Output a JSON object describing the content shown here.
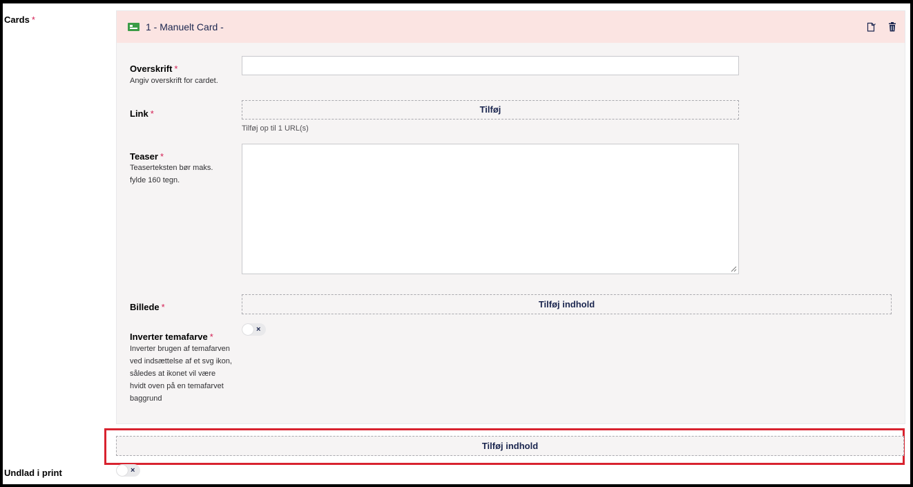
{
  "property": {
    "label": "Cards",
    "required_mark": "*"
  },
  "card": {
    "title": "1 - Manuelt Card -",
    "icon": "card-icon",
    "actions": {
      "copy_icon": "copy-icon",
      "delete_icon": "trash-icon"
    },
    "fields": {
      "overskrift": {
        "label": "Overskrift",
        "required_mark": "*",
        "description": "Angiv overskrift for cardet.",
        "value": ""
      },
      "link": {
        "label": "Link",
        "required_mark": "*",
        "button_label": "Tilføj",
        "hint": "Tilføj op til 1 URL(s)"
      },
      "teaser": {
        "label": "Teaser",
        "required_mark": "*",
        "description": "Teaserteksten bør maks. fylde 160 tegn.",
        "value": ""
      },
      "billede": {
        "label": "Billede",
        "required_mark": "*",
        "button_label": "Tilføj indhold"
      },
      "inverter": {
        "label": "Inverter temafarve",
        "required_mark": "*",
        "description": "Inverter brugen af temafarven ved indsættelse af et svg ikon, således at ikonet vil være hvidt oven på en temafarvet baggrund",
        "toggle_symbol": "×",
        "checked": false
      }
    }
  },
  "add_content": {
    "button_label": "Tilføj indhold",
    "highlight_color": "#d8232f"
  },
  "undlad_print": {
    "label": "Undlad i print",
    "toggle_symbol": "×",
    "checked": false
  }
}
